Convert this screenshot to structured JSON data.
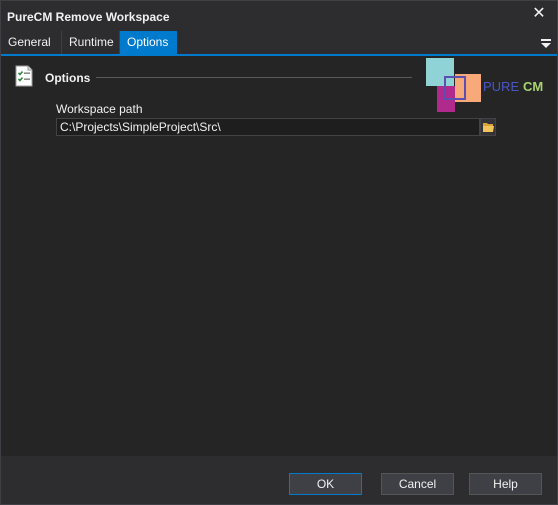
{
  "window": {
    "title": "PureCM Remove Workspace",
    "close_glyph": "✕"
  },
  "tabs": [
    {
      "label": "General",
      "active": false
    },
    {
      "label": "Runtime",
      "active": false
    },
    {
      "label": "Options",
      "active": true
    }
  ],
  "section": {
    "title": "Options",
    "icon": "checklist-icon"
  },
  "logo": {
    "text_pure": "PURE",
    "text_cm": "CM",
    "colors": {
      "teal": "#8fd3d6",
      "orange": "#f7a97a",
      "magenta": "#b02a8d",
      "frame": "#5b4fb0",
      "cm_text": "#a8d46f",
      "pure_text": "#4a56c7"
    }
  },
  "workspace": {
    "label": "Workspace path",
    "value": "C:\\Projects\\SimpleProject\\Src\\"
  },
  "buttons": {
    "ok": "OK",
    "cancel": "Cancel",
    "help": "Help"
  },
  "theme": {
    "accent": "#007acc",
    "background": "#2d2d30"
  }
}
